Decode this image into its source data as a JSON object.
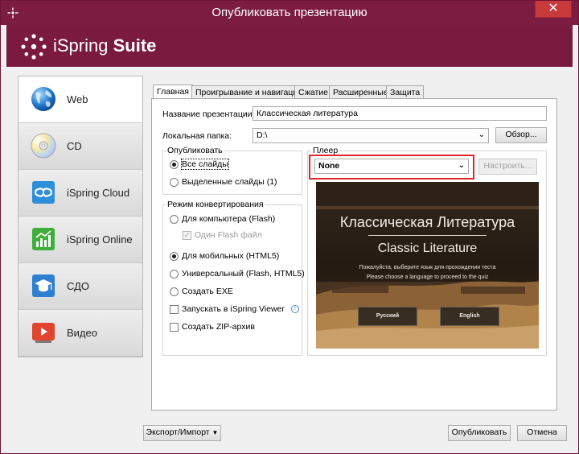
{
  "window": {
    "title": "Опубликовать презентацию",
    "close_label": "✕"
  },
  "banner": {
    "brand_prefix": "iSpring",
    "brand_suffix": "Suite"
  },
  "sidebar": {
    "items": [
      {
        "label": "Web",
        "icon": "globe-icon",
        "active": true
      },
      {
        "label": "CD",
        "icon": "cd-icon"
      },
      {
        "label": "iSpring Cloud",
        "icon": "cloud-icon"
      },
      {
        "label": "iSpring Online",
        "icon": "chart-icon"
      },
      {
        "label": "СДО",
        "icon": "graduation-cap-icon"
      },
      {
        "label": "Видео",
        "icon": "video-play-icon"
      }
    ]
  },
  "tabs": [
    "Главная",
    "Проигрывание и навигация",
    "Сжатие",
    "Расширенные",
    "Защита"
  ],
  "main": {
    "presentation_name_label": "Название презентации:",
    "presentation_name_value": "Классическая литература",
    "local_folder_label": "Локальная папка:",
    "local_folder_value": "D:\\",
    "browse_label": "Обзор...",
    "publish_group": {
      "title": "Опубликовать",
      "all_slides": "Все слайды",
      "selected_slides": "Выделенные слайды (1)"
    },
    "convert_group": {
      "title": "Режим конвертирования",
      "for_pc": "Для компьютера (Flash)",
      "one_flash": "Один Flash файл",
      "for_mobile": "Для мобильных (HTML5)",
      "universal": "Универсальный (Flash, HTML5)",
      "create_exe": "Создать EXE",
      "run_viewer": "Запускать в iSpring Viewer",
      "create_zip": "Создать ZIP-архив"
    },
    "player": {
      "title": "Плеер",
      "selected": "None",
      "configure_label": "Настроить..."
    },
    "preview": {
      "title_ru": "Классическая Литература",
      "title_en": "Classic Literature",
      "prompt_ru": "Пожалуйста, выберите язык для прохождения теста",
      "prompt_en": "Please choose a language to proceed to the quiz",
      "btn_ru": "Русский",
      "btn_en": "English"
    }
  },
  "footer": {
    "export_label": "Экспорт/Импорт",
    "publish_label": "Опубликовать",
    "cancel_label": "Отмена"
  },
  "colors": {
    "brand": "#7a1a3e",
    "highlight": "#e0262b"
  }
}
